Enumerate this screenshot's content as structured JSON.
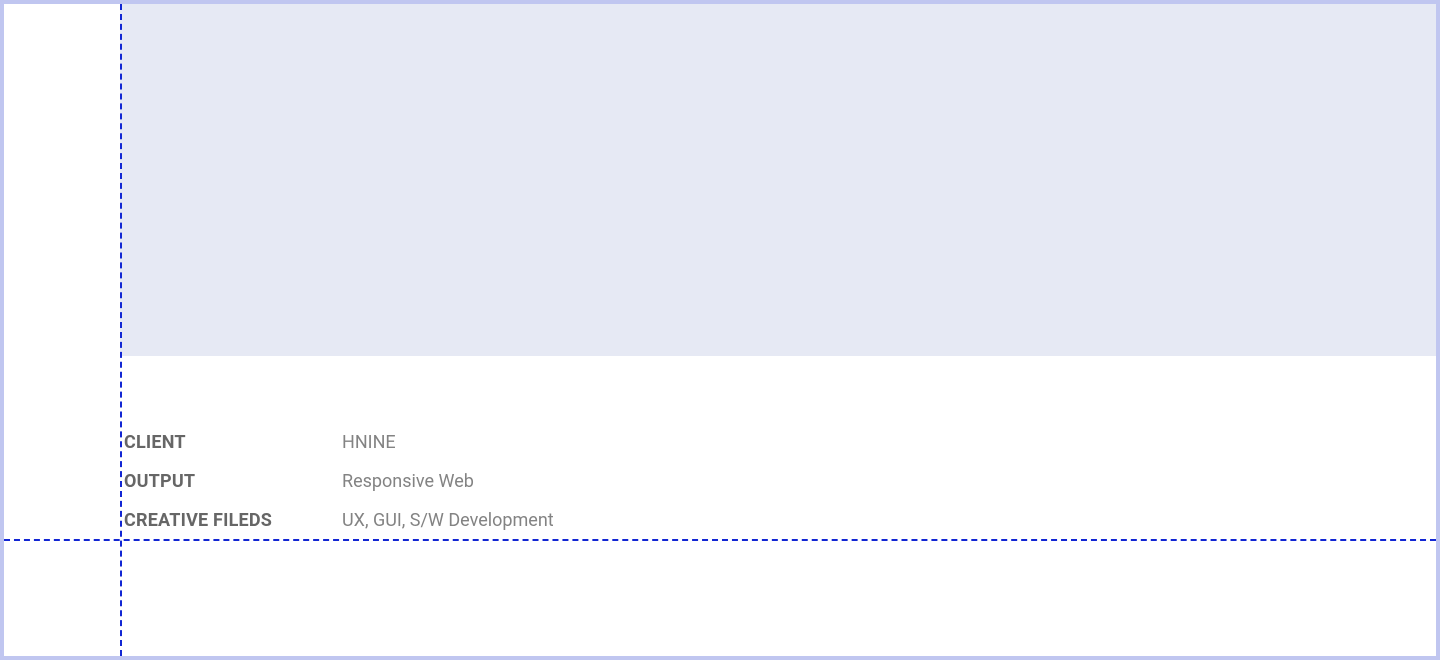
{
  "info": {
    "client": {
      "label": "CLIENT",
      "value": "HNINE"
    },
    "output": {
      "label": "OUTPUT",
      "value": "Responsive Web"
    },
    "creative_fields": {
      "label": "CREATIVE FILEDS",
      "value": "UX, GUI, S/W Development"
    }
  }
}
